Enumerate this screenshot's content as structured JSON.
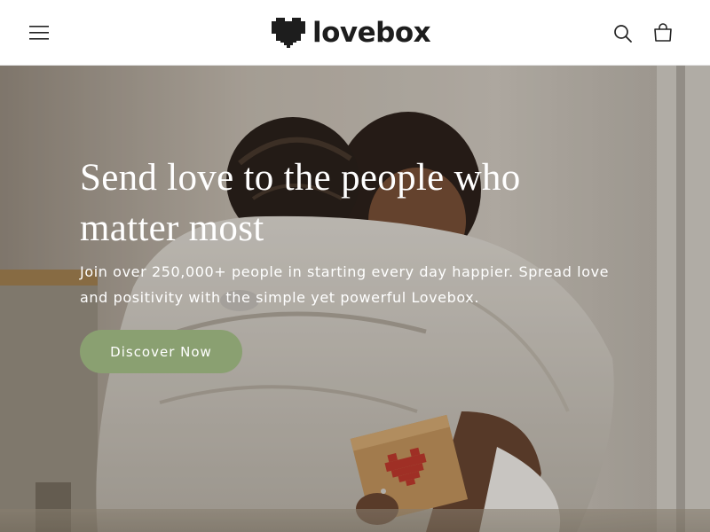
{
  "header": {
    "menu_icon": "hamburger-icon",
    "logo_icon": "pixel-heart-icon",
    "logo_text": "lovebox",
    "search_icon": "search-icon",
    "cart_icon": "shopping-bag-icon"
  },
  "hero": {
    "title": "Send love to the people who matter most",
    "subtitle": "Join over 250,000+ people in starting every day happier. Spread love and positivity with the simple yet powerful Lovebox.",
    "cta_label": "Discover Now",
    "image": "two-people-hugging-with-lovebox-gift"
  },
  "colors": {
    "accent": "#8aa071",
    "logo": "#1d1d1d",
    "box_heart": "#c23a2e"
  }
}
